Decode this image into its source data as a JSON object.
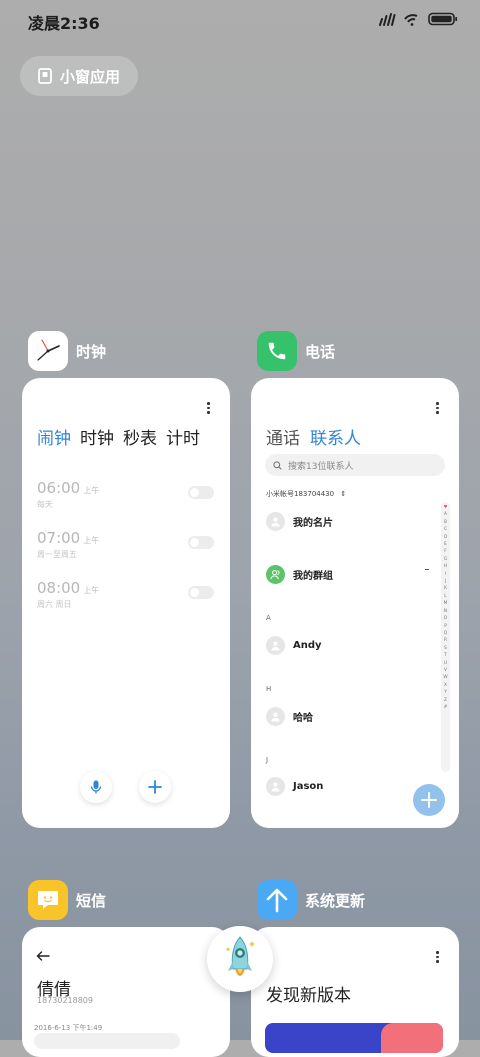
{
  "status_bar": {
    "time": "凌晨2:36"
  },
  "small_window_button": {
    "label": "小窗应用"
  },
  "apps": {
    "clock": {
      "name": "时钟",
      "tabs": [
        "闹钟",
        "时钟",
        "秒表",
        "计时"
      ],
      "active_tab": 0,
      "alarms": [
        {
          "time": "06:00",
          "ampm": "上午",
          "days": "每天",
          "enabled": false
        },
        {
          "time": "07:00",
          "ampm": "上午",
          "days": "周一至周五",
          "enabled": false
        },
        {
          "time": "08:00",
          "ampm": "上午",
          "days": "周六 周日",
          "enabled": false
        }
      ]
    },
    "phone": {
      "name": "电话",
      "tabs": [
        "通话",
        "联系人"
      ],
      "active_tab": 1,
      "search_placeholder": "搜索13位联系人",
      "account": "小米帐号183704430",
      "my_card": "我的名片",
      "my_groups": "我的群组",
      "sections": [
        {
          "letter": "A",
          "contacts": [
            "Andy"
          ]
        },
        {
          "letter": "H",
          "contacts": [
            "哈哈"
          ]
        },
        {
          "letter": "J",
          "contacts": [
            "Jason"
          ]
        }
      ],
      "index_letters": [
        "♥",
        "A",
        "B",
        "C",
        "D",
        "E",
        "F",
        "G",
        "H",
        "I",
        "J",
        "K",
        "L",
        "M",
        "N",
        "O",
        "P",
        "Q",
        "R",
        "S",
        "T",
        "U",
        "V",
        "W",
        "X",
        "Y",
        "Z",
        "#"
      ]
    },
    "sms": {
      "name": "短信",
      "contact_name": "倩倩",
      "contact_number": "18730218809",
      "message_date": "2016-6-13 下午1:49"
    },
    "update": {
      "name": "系统更新",
      "title": "发现新版本"
    }
  },
  "colors": {
    "accent_blue": "#2e86d8",
    "phone_green": "#36c26a",
    "sms_yellow": "#f8c42a",
    "update_blue": "#49a9f4"
  }
}
